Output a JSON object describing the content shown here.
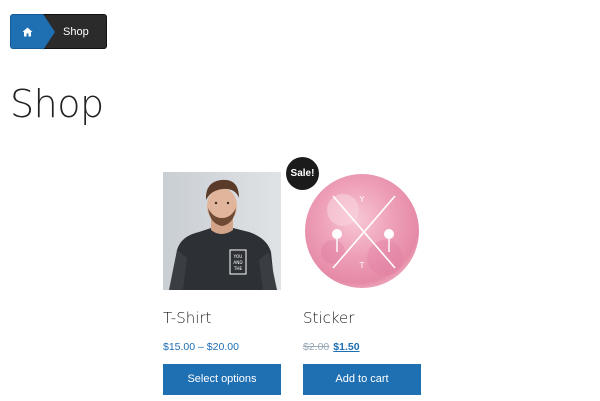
{
  "breadcrumb": {
    "home_icon": "home-icon",
    "current": "Shop"
  },
  "page": {
    "title": "Shop"
  },
  "products": [
    {
      "name": "T-Shirt",
      "price_text": "$15.00 – $20.00",
      "button_label": "Select options",
      "image": "man-in-black-tshirt-photo",
      "shirt_print": [
        "YOU",
        "AND",
        "THE"
      ]
    },
    {
      "name": "Sticker",
      "old_price": "$2.00",
      "new_price": "$1.50",
      "button_label": "Add to cart",
      "badge": "Sale!",
      "image": "pink-watercolor-circle-sticker",
      "sticker_letters": [
        "Y",
        "T"
      ]
    }
  ],
  "colors": {
    "accent": "#1f6fb3",
    "breadcrumb_dark": "#2b2b2b",
    "badge": "#1b1b1b"
  }
}
